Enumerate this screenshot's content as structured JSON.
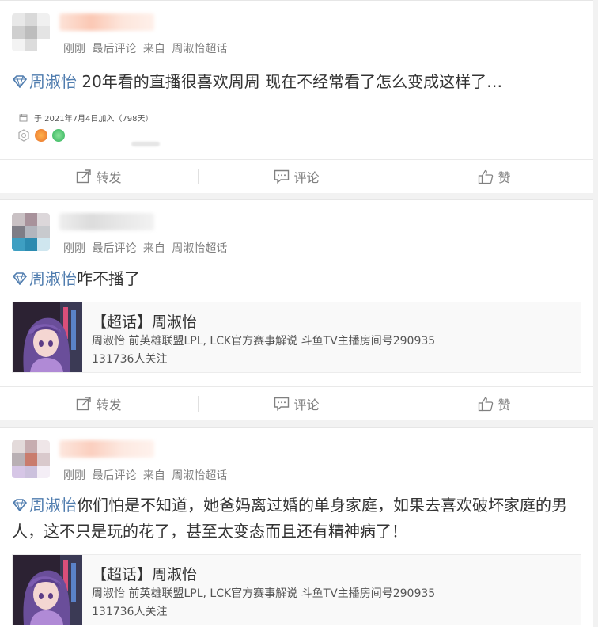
{
  "posts": [
    {
      "meta": {
        "time": "刚刚",
        "tag": "最后评论",
        "from": "来自",
        "source": "周淑怡超话"
      },
      "topic": "周淑怡",
      "text": " 20年看的直播很喜欢周周 现在不经常看了怎么变成这样了…",
      "join_info": "于 2021年7月4日加入（798天）",
      "actions": {
        "repost": "转发",
        "comment": "评论",
        "like": "赞"
      }
    },
    {
      "meta": {
        "time": "刚刚",
        "tag": "最后评论",
        "from": "来自",
        "source": "周淑怡超话"
      },
      "topic": "周淑怡",
      "text": "咋不播了",
      "card": {
        "title": "【超话】周淑怡",
        "desc": "周淑怡 前英雄联盟LPL, LCK官方赛事解说 斗鱼TV主播房间号290935",
        "follow": "131736人关注"
      },
      "actions": {
        "repost": "转发",
        "comment": "评论",
        "like": "赞"
      }
    },
    {
      "meta": {
        "time": "刚刚",
        "tag": "最后评论",
        "from": "来自",
        "source": "周淑怡超话"
      },
      "topic": "周淑怡",
      "text": "你们怕是不知道，她爸妈离过婚的单身家庭，如果去喜欢破坏家庭的男人，这不只是玩的花了，甚至太变态而且还有精神病了！",
      "card": {
        "title": "【超话】周淑怡",
        "desc": "周淑怡 前英雄联盟LPL, LCK官方赛事解说 斗鱼TV主播房间号290935",
        "follow": "131736人关注"
      }
    }
  ],
  "colors": {
    "link": "#507daf",
    "meta": "#808080",
    "text": "#333333"
  }
}
